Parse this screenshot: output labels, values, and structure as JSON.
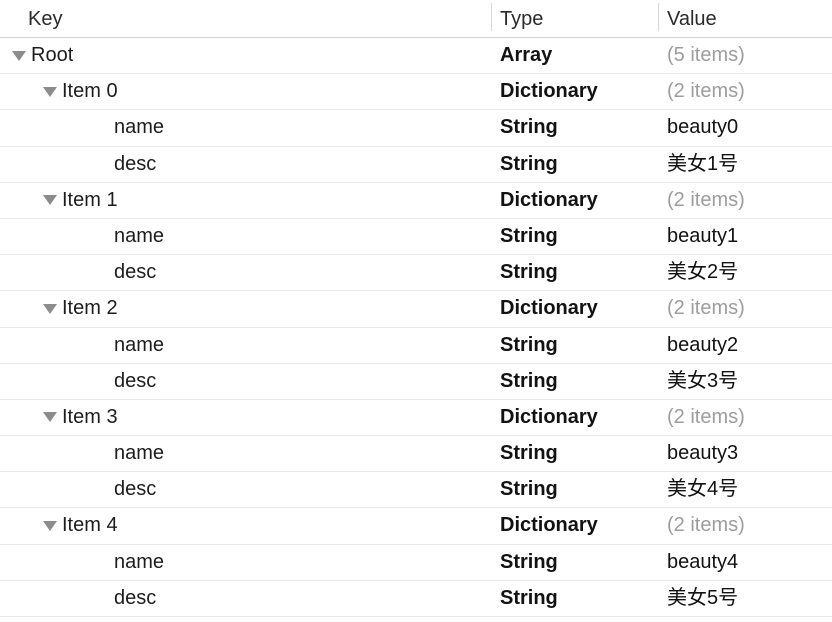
{
  "header": {
    "columns": [
      {
        "id": "key",
        "label": "Key"
      },
      {
        "id": "type",
        "label": "Type"
      },
      {
        "id": "value",
        "label": "Value"
      }
    ]
  },
  "rows": [
    {
      "key": "Root",
      "type": "Array",
      "value": "(5 items)",
      "muted": true,
      "indent": 0,
      "disclosure": "open"
    },
    {
      "key": "Item 0",
      "type": "Dictionary",
      "value": "(2 items)",
      "muted": true,
      "indent": 1,
      "disclosure": "open"
    },
    {
      "key": "name",
      "type": "String",
      "value": "beauty0",
      "muted": false,
      "indent": 2,
      "disclosure": "none"
    },
    {
      "key": "desc",
      "type": "String",
      "value": "美女1号",
      "muted": false,
      "indent": 2,
      "disclosure": "none"
    },
    {
      "key": "Item 1",
      "type": "Dictionary",
      "value": "(2 items)",
      "muted": true,
      "indent": 1,
      "disclosure": "open"
    },
    {
      "key": "name",
      "type": "String",
      "value": "beauty1",
      "muted": false,
      "indent": 2,
      "disclosure": "none"
    },
    {
      "key": "desc",
      "type": "String",
      "value": "美女2号",
      "muted": false,
      "indent": 2,
      "disclosure": "none"
    },
    {
      "key": "Item 2",
      "type": "Dictionary",
      "value": "(2 items)",
      "muted": true,
      "indent": 1,
      "disclosure": "open"
    },
    {
      "key": "name",
      "type": "String",
      "value": "beauty2",
      "muted": false,
      "indent": 2,
      "disclosure": "none"
    },
    {
      "key": "desc",
      "type": "String",
      "value": "美女3号",
      "muted": false,
      "indent": 2,
      "disclosure": "none"
    },
    {
      "key": "Item 3",
      "type": "Dictionary",
      "value": "(2 items)",
      "muted": true,
      "indent": 1,
      "disclosure": "open"
    },
    {
      "key": "name",
      "type": "String",
      "value": "beauty3",
      "muted": false,
      "indent": 2,
      "disclosure": "none"
    },
    {
      "key": "desc",
      "type": "String",
      "value": "美女4号",
      "muted": false,
      "indent": 2,
      "disclosure": "none"
    },
    {
      "key": "Item 4",
      "type": "Dictionary",
      "value": "(2 items)",
      "muted": true,
      "indent": 1,
      "disclosure": "open"
    },
    {
      "key": "name",
      "type": "String",
      "value": "beauty4",
      "muted": false,
      "indent": 2,
      "disclosure": "none"
    },
    {
      "key": "desc",
      "type": "String",
      "value": "美女5号",
      "muted": false,
      "indent": 2,
      "disclosure": "none"
    }
  ],
  "colors": {
    "background": "#ffffff",
    "row_separator": "#e8e8e8",
    "header_separator": "#d2d2d2",
    "column_divider": "#d6d6d6",
    "text_primary": "#1d1d1d",
    "text_muted": "#9d9d9d",
    "disclosure_triangle": "#8c8c8c"
  }
}
